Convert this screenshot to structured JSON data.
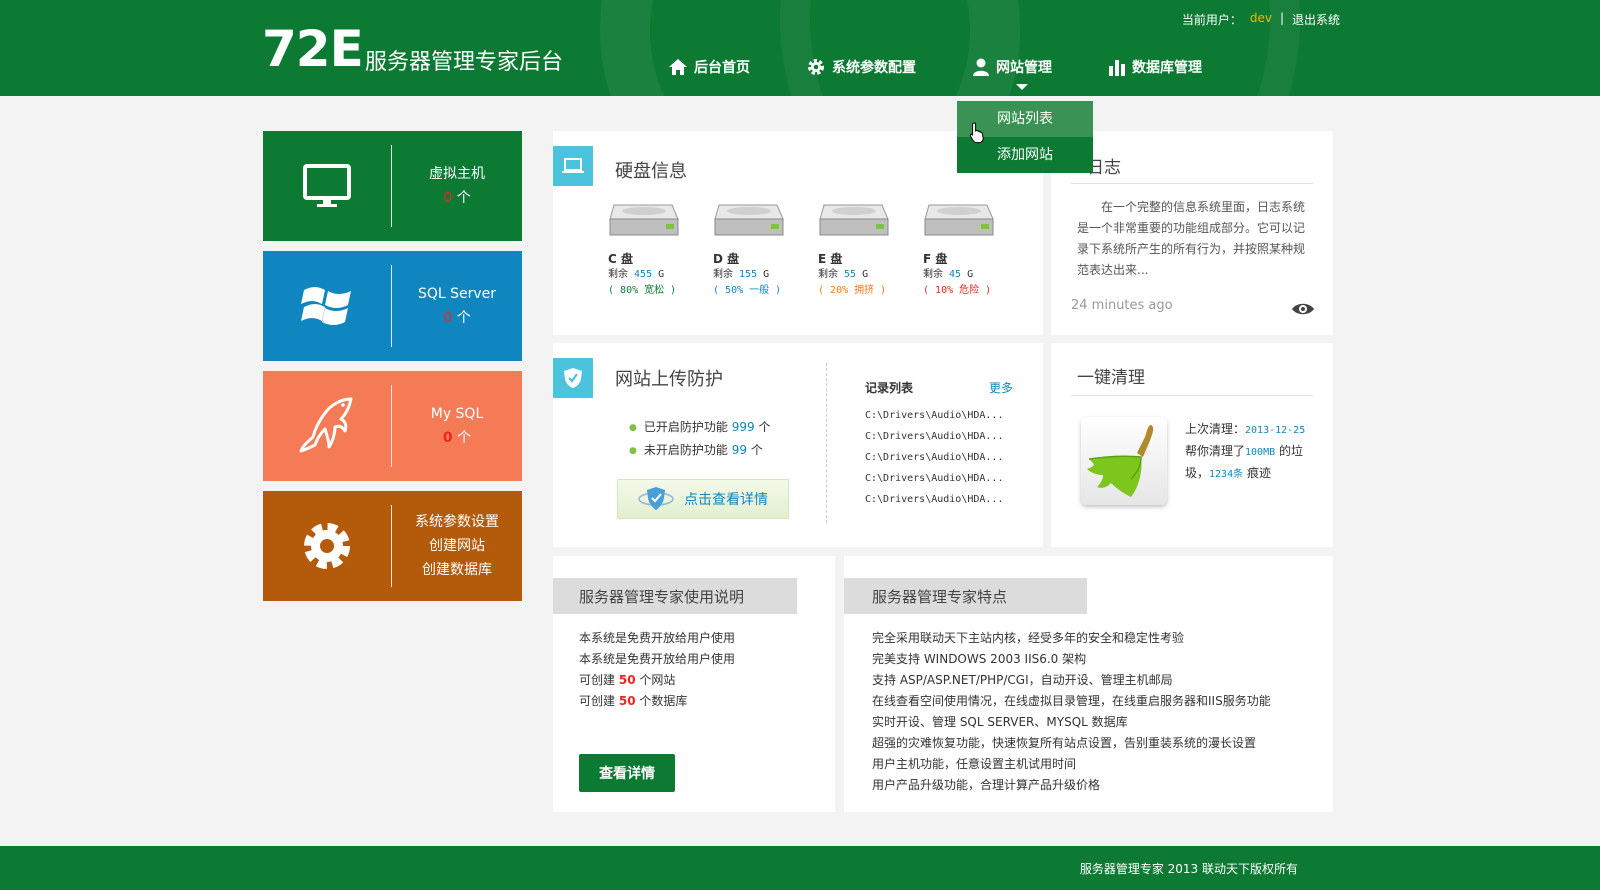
{
  "header": {
    "logo_mark": "72E",
    "title": "服务器管理专家后台",
    "user_label": "当前用户：",
    "username": "dev",
    "separator": "|",
    "logout": "退出系统",
    "nav": [
      {
        "label": "后台首页",
        "icon": "home-icon"
      },
      {
        "label": "系统参数配置",
        "icon": "gear-icon"
      },
      {
        "label": "网站管理",
        "icon": "user-icon",
        "active": true
      },
      {
        "label": "数据库管理",
        "icon": "bar-chart-icon"
      }
    ],
    "dropdown": [
      "网站列表",
      "添加网站"
    ]
  },
  "tiles": [
    {
      "title": "虚拟主机",
      "count": "0",
      "unit": "个",
      "icon": "monitor-icon",
      "color": "#0c7a32"
    },
    {
      "title": "SQL Server",
      "count": "0",
      "unit": "个",
      "icon": "windows-icon",
      "color": "#0f86bf"
    },
    {
      "title": "My SQL",
      "count": "0",
      "unit": "个",
      "icon": "dolphin-icon",
      "color": "#f57b56"
    },
    {
      "lines": [
        "系统参数设置",
        "创建网站",
        "创建数据库"
      ],
      "icon": "gear-icon",
      "color": "#b45a0b"
    }
  ],
  "disk": {
    "title": "硬盘信息",
    "drives": [
      {
        "label": "C 盘",
        "remain_label": "剩余",
        "free": "455",
        "unit": "G",
        "pct": "80%",
        "status": "宽松",
        "color": "#0c7a32"
      },
      {
        "label": "D 盘",
        "remain_label": "剩余",
        "free": "155",
        "unit": "G",
        "pct": "50%",
        "status": "一般",
        "color": "#0f86bf"
      },
      {
        "label": "E 盘",
        "remain_label": "剩余",
        "free": "55",
        "unit": "G",
        "pct": "20%",
        "status": "拥挤",
        "color": "#f07a1a"
      },
      {
        "label": "F 盘",
        "remain_label": "剩余",
        "free": "45",
        "unit": "G",
        "pct": "10%",
        "status": "危险",
        "color": "#e8281e"
      }
    ]
  },
  "log": {
    "title": "日志",
    "text": "在一个完整的信息系统里面，日志系统是一个非常重要的功能组成部分。它可以记录下系统所产生的所有行为，并按照某种规范表达出来...",
    "time": "24 minutes ago"
  },
  "protect": {
    "title": "网站上传防护",
    "enabled_label": "已开启防护功能",
    "enabled_count": "999",
    "disabled_label": "未开启防护功能",
    "disabled_count": "99",
    "unit": "个",
    "detail_button": "点击查看详情",
    "records_title": "记录列表",
    "more": "更多",
    "records": [
      "C:\\Drivers\\Audio\\HDA...",
      "C:\\Drivers\\Audio\\HDA...",
      "C:\\Drivers\\Audio\\HDA...",
      "C:\\Drivers\\Audio\\HDA...",
      "C:\\Drivers\\Audio\\HDA..."
    ]
  },
  "clean": {
    "title": "一键清理",
    "last_label": "上次清理：",
    "last_date": "2013-12-25",
    "cleaned_prefix": "帮你清理了",
    "cleaned_size": "100MB",
    "cleaned_mid": "的垃圾，",
    "cleaned_count": "1234条",
    "cleaned_suffix": "痕迹"
  },
  "usage": {
    "title": "服务器管理专家使用说明",
    "lines": [
      "本系统是免费开放给用户使用",
      "本系统是免费开放给用户使用"
    ],
    "site_prefix": "可创建",
    "site_count": "50",
    "site_suffix": "个网站",
    "db_prefix": "可创建",
    "db_count": "50",
    "db_suffix": "个数据库",
    "button": "查看详情"
  },
  "features": {
    "title": "服务器管理专家特点",
    "lines": [
      "完全采用联动天下主站内核，经受多年的安全和稳定性考验",
      "完美支持 WINDOWS 2003 IIS6.0 架构",
      "支持 ASP/ASP.NET/PHP/CGI，自动开设、管理主机邮局",
      "在线查看空间使用情况，在线虚拟目录管理，在线重启服务器和IIS服务功能",
      "实时开设、管理 SQL SERVER、MYSQL 数据库",
      "超强的灾难恢复功能，快速恢复所有站点设置，告别重装系统的漫长设置",
      "用户主机功能，任意设置主机试用时间",
      "用户产品升级功能，合理计算产品升级价格"
    ]
  },
  "footer": {
    "copyright": "服务器管理专家 2013 联动天下版权所有"
  }
}
